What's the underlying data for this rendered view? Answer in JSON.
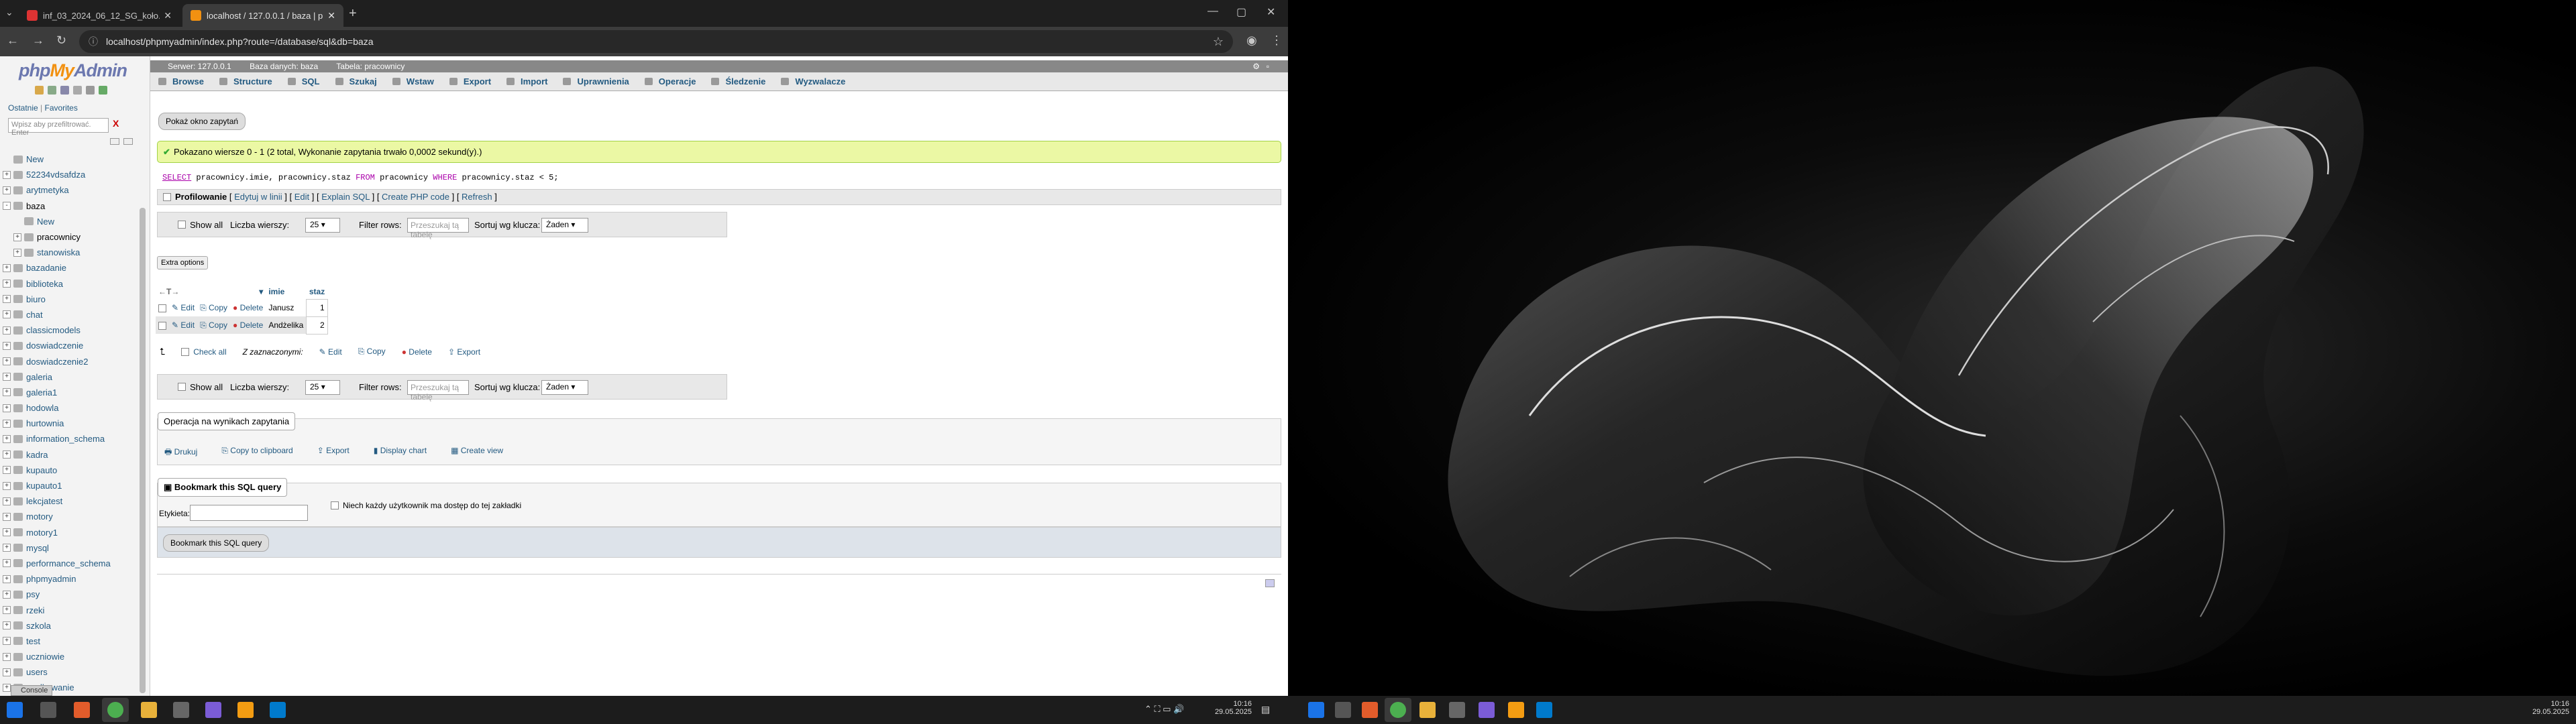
{
  "browser": {
    "tabs": [
      {
        "title": "inf_03_2024_06_12_SG_koło.pdf",
        "active": false
      },
      {
        "title": "localhost / 127.0.0.1 / baza | ph",
        "active": true
      }
    ],
    "url": "localhost/phpmyadmin/index.php?route=/database/sql&db=baza"
  },
  "sidebar": {
    "logo": {
      "php": "php",
      "my": "My",
      "admin": "Admin"
    },
    "recent": "Ostatnie",
    "favorites": "Favorites",
    "filter_placeholder": "Wpisz aby przefiltrować. Enter",
    "clear": "X",
    "databases": [
      {
        "name": "New",
        "level": 0,
        "expander": ""
      },
      {
        "name": "52234vdsafdza",
        "level": 0,
        "expander": "+"
      },
      {
        "name": "arytmetyka",
        "level": 0,
        "expander": "+"
      },
      {
        "name": "baza",
        "level": 0,
        "expander": "-",
        "selected": true
      },
      {
        "name": "New",
        "level": 1,
        "expander": ""
      },
      {
        "name": "pracownicy",
        "level": 1,
        "expander": "+",
        "selected": true
      },
      {
        "name": "stanowiska",
        "level": 1,
        "expander": "+"
      },
      {
        "name": "bazadanie",
        "level": 0,
        "expander": "+"
      },
      {
        "name": "biblioteka",
        "level": 0,
        "expander": "+"
      },
      {
        "name": "biuro",
        "level": 0,
        "expander": "+"
      },
      {
        "name": "chat",
        "level": 0,
        "expander": "+"
      },
      {
        "name": "classicmodels",
        "level": 0,
        "expander": "+"
      },
      {
        "name": "doswiadczenie",
        "level": 0,
        "expander": "+"
      },
      {
        "name": "doswiadczenie2",
        "level": 0,
        "expander": "+"
      },
      {
        "name": "galeria",
        "level": 0,
        "expander": "+"
      },
      {
        "name": "galeria1",
        "level": 0,
        "expander": "+"
      },
      {
        "name": "hodowla",
        "level": 0,
        "expander": "+"
      },
      {
        "name": "hurtownia",
        "level": 0,
        "expander": "+"
      },
      {
        "name": "information_schema",
        "level": 0,
        "expander": "+"
      },
      {
        "name": "kadra",
        "level": 0,
        "expander": "+"
      },
      {
        "name": "kupauto",
        "level": 0,
        "expander": "+"
      },
      {
        "name": "kupauto1",
        "level": 0,
        "expander": "+"
      },
      {
        "name": "lekcjatest",
        "level": 0,
        "expander": "+"
      },
      {
        "name": "motory",
        "level": 0,
        "expander": "+"
      },
      {
        "name": "motory1",
        "level": 0,
        "expander": "+"
      },
      {
        "name": "mysql",
        "level": 0,
        "expander": "+"
      },
      {
        "name": "performance_schema",
        "level": 0,
        "expander": "+"
      },
      {
        "name": "phpmyadmin",
        "level": 0,
        "expander": "+"
      },
      {
        "name": "psy",
        "level": 0,
        "expander": "+"
      },
      {
        "name": "rzeki",
        "level": 0,
        "expander": "+"
      },
      {
        "name": "szkola",
        "level": 0,
        "expander": "+"
      },
      {
        "name": "test",
        "level": 0,
        "expander": "+"
      },
      {
        "name": "uczniowie",
        "level": 0,
        "expander": "+"
      },
      {
        "name": "users",
        "level": 0,
        "expander": "+"
      },
      {
        "name": "wedkowanie",
        "level": 0,
        "expander": "+"
      }
    ]
  },
  "breadcrumb": {
    "server": "Serwer: 127.0.0.1",
    "database": "Baza danych: baza",
    "table": "Tabela: pracownicy"
  },
  "tabs": [
    "Browse",
    "Structure",
    "SQL",
    "Szukaj",
    "Wstaw",
    "Export",
    "Import",
    "Uprawnienia",
    "Operacje",
    "Śledzenie",
    "Wyzwalacze"
  ],
  "show_query_window": "Pokaż okno zapytań",
  "success_message": "Pokazano wiersze 0 - 1 (2 total, Wykonanie zapytania trwało 0,0002 sekund(y).)",
  "sql": {
    "select": "SELECT",
    "cols": " pracownicy.imie, pracownicy.staz ",
    "from": "FROM",
    "table": " pracownicy ",
    "where": "WHERE",
    "cond": " pracownicy.staz < 5;"
  },
  "profiling": {
    "label": "Profilowanie",
    "links": [
      "Edytuj w linii",
      "Edit",
      "Explain SQL",
      "Create PHP code",
      "Refresh"
    ]
  },
  "nav": {
    "show_all": "Show all",
    "rows_label": "Liczba wierszy:",
    "rows_value": "25",
    "filter_label": "Filter rows:",
    "filter_placeholder": "Przeszukaj tą tabelę",
    "sort_label": "Sortuj wg klucza:",
    "sort_value": "Żaden"
  },
  "extra_options": "Extra options",
  "results": {
    "columns": [
      "imie",
      "staz"
    ],
    "rows": [
      {
        "imie": "Janusz",
        "staz": "1"
      },
      {
        "imie": "Andżelika",
        "staz": "2"
      }
    ],
    "edit": "Edit",
    "copy": "Copy",
    "delete": "Delete"
  },
  "bulk": {
    "check_all": "Check all",
    "with_selected": "Z zaznaczonymi:",
    "edit": "Edit",
    "copy": "Copy",
    "delete": "Delete",
    "export": "Export"
  },
  "query_ops": {
    "legend": "Operacja na wynikach zapytania",
    "print": "Drukuj",
    "copy_clipboard": "Copy to clipboard",
    "export": "Export",
    "display_chart": "Display chart",
    "create_view": "Create view"
  },
  "bookmark": {
    "legend": "Bookmark this SQL query",
    "label": "Etykieta:",
    "every_user": "Niech każdy użytkownik ma dostęp do tej zakładki",
    "button": "Bookmark this SQL query"
  },
  "console": "Console",
  "taskbar_left": {
    "time": "10:16",
    "date": "29.05.2025"
  },
  "taskbar_right": {
    "time": "10:16",
    "date": "29.05.2025"
  }
}
